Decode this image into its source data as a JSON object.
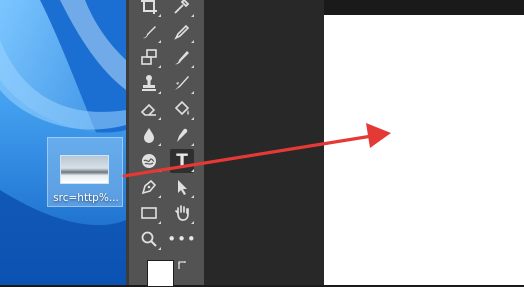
{
  "desktop": {
    "file_icon": {
      "label": "src=http%..."
    }
  },
  "photoshop": {
    "tools": [
      "crop-tool",
      "eyedropper-tool",
      "healing-brush-tool",
      "brush-tool",
      "clone-stamp-tool",
      "history-brush-tool",
      "stamp-tool",
      "art-history-brush-tool",
      "eraser-tool",
      "paint-bucket-tool",
      "blur-tool",
      "smudge-tool",
      "dodge-tool",
      "type-tool",
      "pen-tool",
      "path-selection-tool",
      "rectangle-tool",
      "hand-tool",
      "zoom-tool",
      "more-tools"
    ],
    "type_tool_glyph": "T",
    "more_tools_glyph": "•••",
    "foreground_color": "#ffffff",
    "background_color": "#000000"
  },
  "annotation": {
    "arrow_color": "#e53935"
  },
  "colors": {
    "toolbar_bg": "#535353",
    "panel_bg": "#282828",
    "canvas": "#ffffff",
    "desktop_blue": "#2a8fe0"
  }
}
